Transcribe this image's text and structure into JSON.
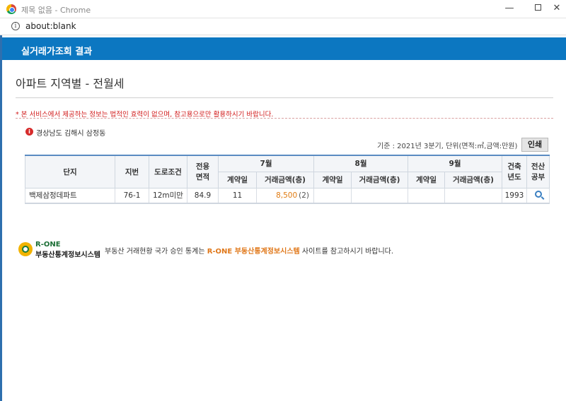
{
  "window": {
    "title": "제목 없음 - Chrome",
    "min_glyph": "—",
    "close_glyph": "✕"
  },
  "addressbar": {
    "info_glyph": "i",
    "url": "about:blank"
  },
  "header": {
    "title": "실거래가조회 결과"
  },
  "page": {
    "title": "아파트 지역별 - 전월세",
    "notice": "* 본 서비스에서 제공하는 정보는 법적인 효력이 없으며, 참고용으로만 활용하시기 바랍니다.",
    "location_glyph": "i",
    "location": "경상남도 김해시 삼정동",
    "basis": "기준 : 2021년 3분기, 단위(면적:㎡,금액:만원)",
    "print_label": "인쇄"
  },
  "table": {
    "headers": {
      "complex": "단지",
      "lot": "지번",
      "road": "도로조건",
      "area_1": "전용",
      "area_2": "면적",
      "m7": "7월",
      "m8": "8월",
      "m9": "9월",
      "built_1": "건축",
      "built_2": "년도",
      "ledger_1": "전산",
      "ledger_2": "공부",
      "contract_day": "계약일",
      "amount": "거래금액(층)"
    },
    "rows": [
      {
        "complex": "백제삼정데파트",
        "lot": "76-1",
        "road": "12m미만",
        "area": "84.9",
        "m7_day": "11",
        "m7_price": "8,500",
        "m7_floor": "(2)",
        "m8_day": "",
        "m8_price": "",
        "m9_day": "",
        "m9_price": "",
        "built": "1993"
      }
    ]
  },
  "footer": {
    "logo_en": "R-ONE",
    "logo_ko": "부동산통계정보시스템",
    "text_before": "부동산 거래현황 국가 승인 통계는 ",
    "text_highlight": "R-ONE 부동산통계정보시스템",
    "text_after": " 사이트를 참고하시기 바랍니다."
  },
  "colors": {
    "header_blue": "#0c77c1",
    "notice_red": "#d11a1a",
    "price_orange": "#e07a10",
    "table_top_border": "#5a8bc2"
  },
  "icons": {
    "browser": "chrome-logo-icon",
    "info": "info-circle-icon",
    "location": "info-red-circle-icon",
    "ledger": "search-magnifier-icon",
    "footer_logo": "r-one-logo-icon"
  }
}
